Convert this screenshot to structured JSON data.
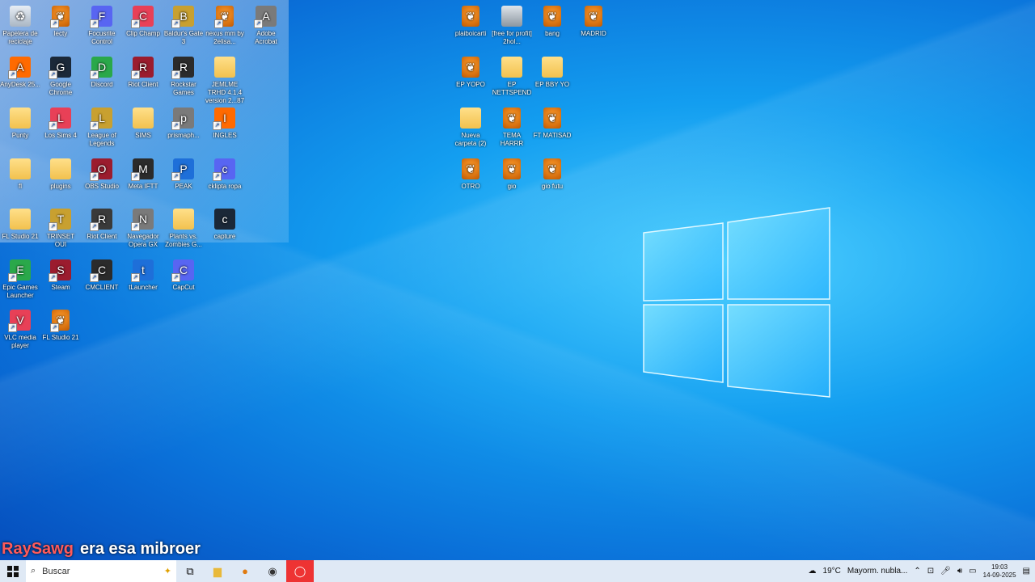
{
  "desktop_icons": [
    {
      "label": "Papelera de reciclaje",
      "kind": "bin",
      "shortcut": false
    },
    {
      "label": "lecty",
      "kind": "fl",
      "shortcut": true
    },
    {
      "label": "Focusrite Control",
      "kind": "app",
      "shortcut": true
    },
    {
      "label": "Clip Champ",
      "kind": "app",
      "shortcut": true
    },
    {
      "label": "Baldur's Gate 3",
      "kind": "app",
      "shortcut": true
    },
    {
      "label": "nexus mm by 2elisa...",
      "kind": "fl",
      "shortcut": true
    },
    {
      "label": "Adobe Acrobat",
      "kind": "app",
      "shortcut": true
    },
    {
      "label": "AnyDesk 25...",
      "kind": "app",
      "shortcut": true
    },
    {
      "label": "Google Chrome",
      "kind": "app",
      "shortcut": true
    },
    {
      "label": "Discord",
      "kind": "app",
      "shortcut": true
    },
    {
      "label": "Riot Client",
      "kind": "app",
      "shortcut": true
    },
    {
      "label": "Rockstar Games",
      "kind": "app",
      "shortcut": true
    },
    {
      "label": "JEMLME TRHD 4.1.4 version 2...87",
      "kind": "folder",
      "shortcut": false
    },
    {
      "label": "Punty",
      "kind": "folder",
      "shortcut": false
    },
    {
      "label": "Los Sims 4",
      "kind": "app",
      "shortcut": true
    },
    {
      "label": "League of Legends",
      "kind": "app",
      "shortcut": true
    },
    {
      "label": "SIMS",
      "kind": "folder",
      "shortcut": false
    },
    {
      "label": "prismaph...",
      "kind": "app",
      "shortcut": true
    },
    {
      "label": "INGLES",
      "kind": "app",
      "shortcut": true
    },
    {
      "label": "fl",
      "kind": "folder",
      "shortcut": false
    },
    {
      "label": "plugins",
      "kind": "folder",
      "shortcut": false
    },
    {
      "label": "OBS Studio",
      "kind": "app",
      "shortcut": true
    },
    {
      "label": "Meta IFTT",
      "kind": "app",
      "shortcut": true
    },
    {
      "label": "PEAK",
      "kind": "app",
      "shortcut": true
    },
    {
      "label": "cklipta ropa",
      "kind": "app",
      "shortcut": true
    },
    {
      "label": "FL Studio 21",
      "kind": "folder",
      "shortcut": false
    },
    {
      "label": "TRINSET OUI",
      "kind": "app",
      "shortcut": true
    },
    {
      "label": "Riot Client",
      "kind": "app",
      "shortcut": true
    },
    {
      "label": "Navegador Opera GX",
      "kind": "app",
      "shortcut": true
    },
    {
      "label": "Plants vs. Zombies G...",
      "kind": "folder",
      "shortcut": false
    },
    {
      "label": "capture",
      "kind": "app",
      "shortcut": false
    },
    {
      "label": "Epic Games Launcher",
      "kind": "app",
      "shortcut": true
    },
    {
      "label": "Steam",
      "kind": "app",
      "shortcut": true
    },
    {
      "label": "CMCLIENT",
      "kind": "app",
      "shortcut": true
    },
    {
      "label": "tLauncher",
      "kind": "app",
      "shortcut": true
    },
    {
      "label": "CapCut",
      "kind": "app",
      "shortcut": true
    },
    {
      "label": "VLC media player",
      "kind": "app",
      "shortcut": true
    },
    {
      "label": "FL Studio 21",
      "kind": "fl",
      "shortcut": true
    },
    {
      "label": "plaiboicarti",
      "kind": "fl",
      "shortcut": false
    },
    {
      "label": "[free for profit] 2hol...",
      "kind": "image",
      "shortcut": false
    },
    {
      "label": "bang",
      "kind": "fl",
      "shortcut": false
    },
    {
      "label": "MADRID",
      "kind": "fl",
      "shortcut": false
    },
    {
      "label": "EP YOPO",
      "kind": "fl",
      "shortcut": false
    },
    {
      "label": "EP NETTSPEND",
      "kind": "folder",
      "shortcut": false
    },
    {
      "label": "EP BBY YO",
      "kind": "folder",
      "shortcut": false
    },
    {
      "label": "Nueva carpeta (2)",
      "kind": "folder",
      "shortcut": false
    },
    {
      "label": "TEMA HARRR",
      "kind": "fl",
      "shortcut": false
    },
    {
      "label": "FT MATISAD",
      "kind": "fl",
      "shortcut": false
    },
    {
      "label": "OTRO",
      "kind": "fl",
      "shortcut": false
    },
    {
      "label": "gio",
      "kind": "fl",
      "shortcut": false
    },
    {
      "label": "gio futu",
      "kind": "fl",
      "shortcut": false
    }
  ],
  "overlay": {
    "name": "RaySawg",
    "message": "era esa mibroer"
  },
  "taskbar": {
    "search_placeholder": "Buscar",
    "weather": "19°C",
    "weather_desc": "Mayorm. nubla...",
    "time": "19:03",
    "date": "14-09-2025"
  },
  "colors": {
    "desktop": "#139ef0",
    "taskbar": "#dfe9f5",
    "overlay_name": "#ff5a5a"
  }
}
